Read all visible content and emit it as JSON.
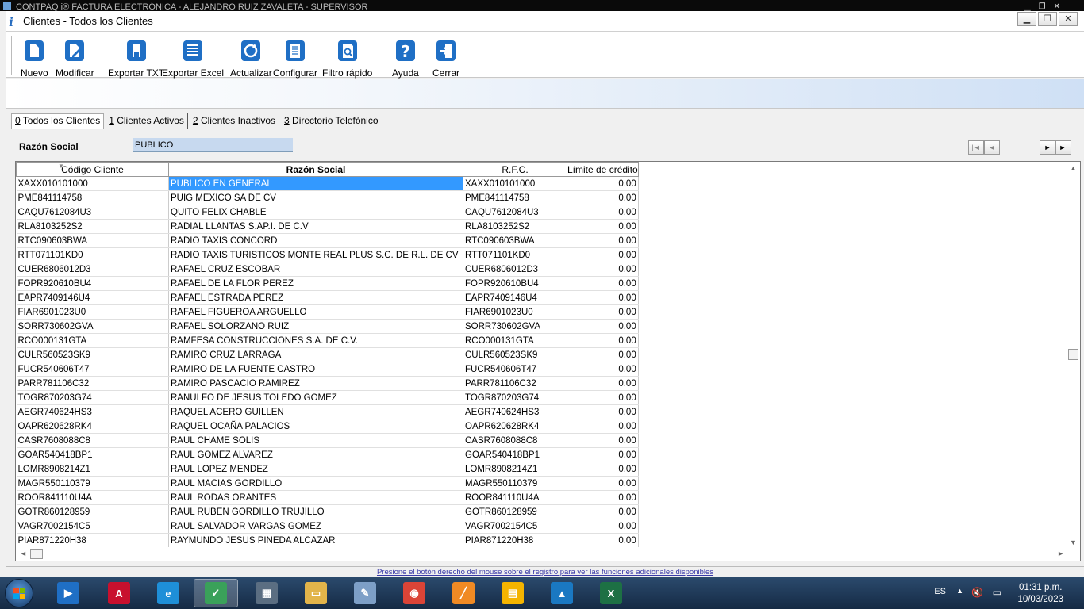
{
  "window": {
    "app_title": "CONTPAQ i® FACTURA ELECTRÓNICA  -  ALEJANDRO RUIZ ZAVALETA  -  SUPERVISOR",
    "child_title": "Clientes - Todos los Clientes"
  },
  "toolbar": [
    {
      "label": "Nuevo",
      "icon": "new-document-icon"
    },
    {
      "label": "Modificar",
      "icon": "edit-document-icon"
    },
    {
      "label": "Exportar TXT",
      "icon": "export-txt-icon"
    },
    {
      "label": "Exportar Excel",
      "icon": "export-excel-icon"
    },
    {
      "label": "Actualizar",
      "icon": "refresh-icon"
    },
    {
      "label": "Configurar",
      "icon": "configure-icon"
    },
    {
      "label": "Filtro rápido",
      "icon": "quick-filter-icon"
    },
    {
      "label": "Ayuda",
      "icon": "help-icon"
    },
    {
      "label": "Cerrar",
      "icon": "exit-icon"
    }
  ],
  "tabs": [
    {
      "key": "0",
      "label": " Todos los Clientes",
      "active": true
    },
    {
      "key": "1",
      "label": " Clientes Activos",
      "active": false
    },
    {
      "key": "2",
      "label": " Clientes Inactivos",
      "active": false
    },
    {
      "key": "3",
      "label": " Directorio Telefónico",
      "active": false
    }
  ],
  "filter": {
    "label": "Razón Social",
    "value": "PUBLICO"
  },
  "navigation": {
    "first": "|◄",
    "prev": "◄",
    "next": "►",
    "last": "►|"
  },
  "grid": {
    "columns": [
      "Código Cliente",
      "Razón Social",
      "R.F.C.",
      "Límite de crédito"
    ],
    "rows": [
      [
        "XAXX010101000",
        "PUBLICO EN GENERAL",
        "XAXX010101000",
        "0.00"
      ],
      [
        "PME841114758",
        "PUIG MEXICO SA DE CV",
        "PME841114758",
        "0.00"
      ],
      [
        "CAQU7612084U3",
        "QUITO FELIX CHABLE",
        "CAQU7612084U3",
        "0.00"
      ],
      [
        "RLA8103252S2",
        "RADIAL LLANTAS S.AP.I. DE C.V",
        "RLA8103252S2",
        "0.00"
      ],
      [
        "RTC090603BWA",
        "RADIO TAXIS CONCORD",
        "RTC090603BWA",
        "0.00"
      ],
      [
        "RTT071101KD0",
        "RADIO TAXIS TURISTICOS MONTE REAL PLUS S.C. DE R.L. DE CV",
        "RTT071101KD0",
        "0.00"
      ],
      [
        "CUER6806012D3",
        "RAFAEL CRUZ ESCOBAR",
        "CUER6806012D3",
        "0.00"
      ],
      [
        "FOPR920610BU4",
        "RAFAEL DE LA FLOR PEREZ",
        "FOPR920610BU4",
        "0.00"
      ],
      [
        "EAPR7409146U4",
        "RAFAEL ESTRADA PEREZ",
        "EAPR7409146U4",
        "0.00"
      ],
      [
        "FIAR6901023U0",
        "RAFAEL FIGUEROA  ARGUELLO",
        "FIAR6901023U0",
        "0.00"
      ],
      [
        "SORR730602GVA",
        "RAFAEL SOLORZANO RUIZ",
        "SORR730602GVA",
        "0.00"
      ],
      [
        "RCO000131GTA",
        "RAMFESA CONSTRUCCIONES S.A. DE C.V.",
        "RCO000131GTA",
        "0.00"
      ],
      [
        "CULR560523SK9",
        "RAMIRO CRUZ LARRAGA",
        "CULR560523SK9",
        "0.00"
      ],
      [
        "FUCR540606T47",
        "RAMIRO DE LA FUENTE CASTRO",
        "FUCR540606T47",
        "0.00"
      ],
      [
        "PARR781106C32",
        "RAMIRO PASCACIO RAMIREZ",
        "PARR781106C32",
        "0.00"
      ],
      [
        "TOGR870203G74",
        "RANULFO DE JESUS TOLEDO GOMEZ",
        "TOGR870203G74",
        "0.00"
      ],
      [
        "AEGR740624HS3",
        "RAQUEL ACERO GUILLEN",
        "AEGR740624HS3",
        "0.00"
      ],
      [
        "OAPR620628RK4",
        "RAQUEL OCAÑA PALACIOS",
        "OAPR620628RK4",
        "0.00"
      ],
      [
        "CASR7608088C8",
        "RAUL CHAME SOLIS",
        "CASR7608088C8",
        "0.00"
      ],
      [
        "GOAR540418BP1",
        "RAUL GOMEZ ALVAREZ",
        "GOAR540418BP1",
        "0.00"
      ],
      [
        "LOMR8908214Z1",
        "RAUL LOPEZ MENDEZ",
        "LOMR8908214Z1",
        "0.00"
      ],
      [
        "MAGR550110379",
        "RAUL MACIAS GORDILLO",
        "MAGR550110379",
        "0.00"
      ],
      [
        "ROOR841110U4A",
        "RAUL RODAS ORANTES",
        "ROOR841110U4A",
        "0.00"
      ],
      [
        "GOTR860128959",
        "RAUL RUBEN GORDILLO TRUJILLO",
        "GOTR860128959",
        "0.00"
      ],
      [
        "VAGR7002154C5",
        "RAUL SALVADOR VARGAS GOMEZ",
        "VAGR7002154C5",
        "0.00"
      ],
      [
        "PIAR871220H38",
        "RAYMUNDO JESUS PINEDA ALCAZAR",
        "PIAR871220H38",
        "0.00"
      ]
    ],
    "selected_row": 0
  },
  "status_bar": "Presione el botón derecho del mouse sobre el registro para ver las funciones adicionales disponibles",
  "taskbar": {
    "apps": [
      {
        "name": "media-player",
        "color": "#1f6fc5",
        "glyph": "▶"
      },
      {
        "name": "acrobat",
        "color": "#c8102e",
        "glyph": "A"
      },
      {
        "name": "edge",
        "color": "#1e8fd8",
        "glyph": "e"
      },
      {
        "name": "contpaqi",
        "color": "#3aa15a",
        "glyph": "✓",
        "active": true
      },
      {
        "name": "calculator",
        "color": "#5b6e82",
        "glyph": "▦"
      },
      {
        "name": "file-explorer",
        "color": "#e2b44a",
        "glyph": "▭"
      },
      {
        "name": "paint",
        "color": "#7d9fc7",
        "glyph": "✎"
      },
      {
        "name": "chrome",
        "color": "#db4437",
        "glyph": "◉"
      },
      {
        "name": "chart-app",
        "color": "#f08a24",
        "glyph": "╱"
      },
      {
        "name": "slides",
        "color": "#f4b400",
        "glyph": "▤"
      },
      {
        "name": "app-triangle",
        "color": "#1a78c2",
        "glyph": "▲"
      },
      {
        "name": "excel",
        "color": "#1d7044",
        "glyph": "X"
      }
    ],
    "language": "ES",
    "time": "01:31 p.m.",
    "date": "10/03/2023"
  },
  "colors": {
    "selection": "#3399ff",
    "filter_bg": "#c7d9ef",
    "toolbar_icon": "#1f6fc5"
  }
}
